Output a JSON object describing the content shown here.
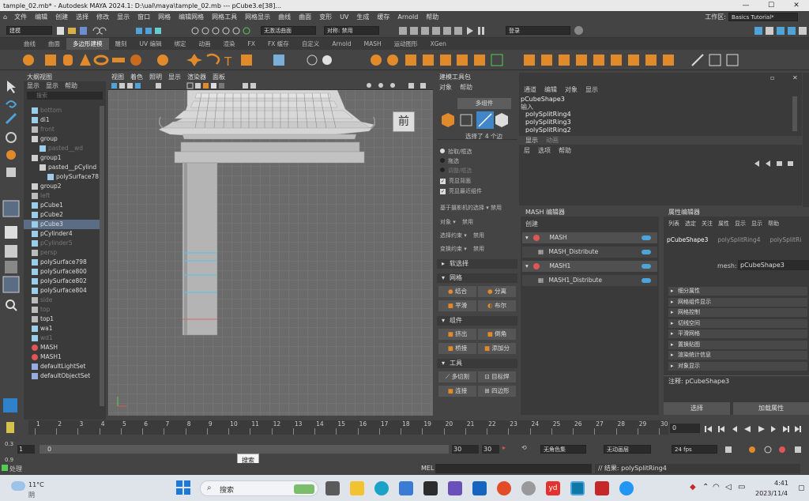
{
  "window": {
    "title": "tample_02.mb* - Autodesk MAYA 2024.1: D:\\ual\\maya\\tample_02.mb   ---   pCube3.e[38]..."
  },
  "menubar": {
    "items": [
      "文件",
      "编辑",
      "创建",
      "选择",
      "修改",
      "显示",
      "窗口",
      "网格",
      "编辑网格",
      "网格工具",
      "网格显示",
      "曲线",
      "曲面",
      "变形",
      "UV",
      "生成",
      "缓存",
      "Arnold",
      "帮助"
    ],
    "workspace_label": "工作区:",
    "workspace_value": "Basics Tutorial*"
  },
  "statusline": {
    "mode": "建模",
    "live_surface": "无激活曲面",
    "symmetry": "对称: 禁用",
    "login": "登录"
  },
  "shelf": {
    "tabs": [
      "曲线",
      "曲面",
      "多边形建模",
      "雕刻",
      "UV 编辑",
      "绑定",
      "动画",
      "渲染",
      "FX",
      "FX 缓存",
      "自定义",
      "Arnold",
      "MASH",
      "运动图形",
      "XGen"
    ],
    "active_tab": 2
  },
  "outliner": {
    "title": "大纲视图",
    "menu": [
      "显示",
      "显示",
      "帮助"
    ],
    "search_placeholder": "搜索",
    "rows": [
      {
        "label": "bottom",
        "dim": true,
        "indent": 1,
        "kind": "mesh"
      },
      {
        "label": "di1",
        "dim": false,
        "indent": 1,
        "kind": "mesh"
      },
      {
        "label": "front",
        "dim": true,
        "indent": 1,
        "kind": "camera"
      },
      {
        "label": "group",
        "dim": false,
        "indent": 1,
        "kind": "group"
      },
      {
        "label": "pasted__wd",
        "dim": true,
        "indent": 2,
        "kind": "mesh"
      },
      {
        "label": "group1",
        "dim": false,
        "indent": 1,
        "kind": "group"
      },
      {
        "label": "pasted__pCylind",
        "dim": false,
        "indent": 2,
        "kind": "group"
      },
      {
        "label": "polySurface78",
        "dim": false,
        "indent": 3,
        "kind": "mesh"
      },
      {
        "label": "group2",
        "dim": false,
        "indent": 1,
        "kind": "group"
      },
      {
        "label": "left",
        "dim": true,
        "indent": 1,
        "kind": "camera"
      },
      {
        "label": "pCube1",
        "dim": false,
        "indent": 1,
        "kind": "mesh"
      },
      {
        "label": "pCube2",
        "dim": false,
        "indent": 1,
        "kind": "mesh"
      },
      {
        "label": "pCube3",
        "dim": false,
        "indent": 1,
        "kind": "mesh",
        "selected": true
      },
      {
        "label": "pCylinder4",
        "dim": false,
        "indent": 1,
        "kind": "mesh"
      },
      {
        "label": "pCylinder5",
        "dim": true,
        "indent": 1,
        "kind": "mesh"
      },
      {
        "label": "persp",
        "dim": true,
        "indent": 1,
        "kind": "camera"
      },
      {
        "label": "polySurface798",
        "dim": false,
        "indent": 1,
        "kind": "mesh"
      },
      {
        "label": "polySurface800",
        "dim": false,
        "indent": 1,
        "kind": "mesh"
      },
      {
        "label": "polySurface802",
        "dim": false,
        "indent": 1,
        "kind": "mesh"
      },
      {
        "label": "polySurface804",
        "dim": false,
        "indent": 1,
        "kind": "mesh"
      },
      {
        "label": "side",
        "dim": true,
        "indent": 1,
        "kind": "camera"
      },
      {
        "label": "top",
        "dim": true,
        "indent": 1,
        "kind": "camera"
      },
      {
        "label": "top1",
        "dim": false,
        "indent": 1,
        "kind": "camera"
      },
      {
        "label": "wa1",
        "dim": false,
        "indent": 1,
        "kind": "mesh"
      },
      {
        "label": "wd1",
        "dim": true,
        "indent": 1,
        "kind": "mesh"
      },
      {
        "label": "MASH",
        "dim": false,
        "indent": 1,
        "kind": "mash"
      },
      {
        "label": "MASH1",
        "dim": false,
        "indent": 1,
        "kind": "mash"
      },
      {
        "label": "defaultLightSet",
        "dim": false,
        "indent": 1,
        "kind": "set"
      },
      {
        "label": "defaultObjectSet",
        "dim": false,
        "indent": 1,
        "kind": "set"
      }
    ]
  },
  "viewport": {
    "menu": [
      "视图",
      "着色",
      "照明",
      "显示",
      "渲染器",
      "面板"
    ],
    "view_cube_label": "前"
  },
  "toolkit": {
    "title": "建模工具包",
    "menu": [
      "对象",
      "帮助"
    ],
    "multi_component": "多组件",
    "selected_count": "选择了 4 个边",
    "radio_pick": "拾取/框选",
    "radio_drag": "拖选",
    "radio_tweak": "调整/框选",
    "check_backface": "亮显背面",
    "check_nearest": "亮显最近组件",
    "camera_based": "基于摄影机的选择",
    "camera_based_value": "禁用",
    "object_label": "对象",
    "object_value": "禁用",
    "select_constraint": "选择约束",
    "select_constraint_value": "禁用",
    "transform_constraint": "变换约束",
    "transform_constraint_value": "禁用",
    "soft_select": "软选择",
    "section_mesh": "网格",
    "btn_combine": "结合",
    "btn_separate": "分离",
    "btn_smooth": "平滑",
    "btn_boolean": "布尔",
    "section_component": "组件",
    "btn_extrude": "挤出",
    "btn_bevel": "倒角",
    "btn_bridge": "桥接",
    "btn_add_div": "添加分",
    "section_tools": "工具",
    "btn_multicut": "多切割",
    "btn_target_weld": "目标焊",
    "btn_connect": "连接",
    "btn_quad_draw": "四边形"
  },
  "channelbox": {
    "menu": [
      "通道",
      "编辑",
      "对象",
      "显示"
    ],
    "object": "pCubeShape3",
    "inputs_label": "输入",
    "inputs": [
      "polySplitRing4",
      "polySplitRing3",
      "polySplitRing2"
    ],
    "tabs": [
      "显示",
      "动画"
    ],
    "layer_menu": [
      "层",
      "选项",
      "帮助"
    ]
  },
  "mash": {
    "title": "MASH 编辑器",
    "create": "创建",
    "rows": [
      {
        "label": "MASH",
        "kind": "network"
      },
      {
        "label": "MASH_Distribute",
        "kind": "node"
      },
      {
        "label": "MASH1",
        "kind": "network"
      },
      {
        "label": "MASH1_Distribute",
        "kind": "node"
      }
    ]
  },
  "attr": {
    "title": "属性编辑器",
    "menu": [
      "列表",
      "选定",
      "关注",
      "属性",
      "显示",
      "显示",
      "帮助"
    ],
    "tabs": [
      "pCubeShape3",
      "polySplitRing4",
      "polySplitRi"
    ],
    "mesh_label": "mesh:",
    "mesh_value": "pCubeShape3",
    "sections": [
      "细分属性",
      "网格组件显示",
      "网格控制",
      "切线空间",
      "平滑网格",
      "置换贴图",
      "渲染统计信息",
      "对象显示"
    ],
    "note_label": "注释:",
    "note_value": "pCubeShape3",
    "select_btn": "选择",
    "load_btn": "加载属性"
  },
  "timeline": {
    "ticks": [
      "1",
      "2",
      "3",
      "4",
      "5",
      "6",
      "7",
      "8",
      "9",
      "10",
      "11",
      "12",
      "13",
      "14",
      "15",
      "16",
      "17",
      "18",
      "19",
      "20",
      "21",
      "22",
      "23",
      "24",
      "25",
      "26",
      "27",
      "28",
      "29",
      "30"
    ],
    "current_frame": "0",
    "left_labels": [
      "0.3",
      "0.9"
    ],
    "range_start": "1",
    "range_start_inner": "0",
    "range_end_inner": "30",
    "range_end": "30",
    "char_set": "无角色集",
    "anim_layer": "无动画层",
    "fps": "24 fps"
  },
  "cmdline": {
    "mel": "MEL",
    "result": "// 结果: polySplitRing4",
    "status_left": "处理"
  },
  "tooltip": "搜索",
  "taskbar": {
    "weather_temp": "11°C",
    "weather_desc": "阴",
    "search": "搜索",
    "time": "4:41",
    "date": "2023/11/4",
    "lang": "中",
    "badge_yd": "yd"
  }
}
